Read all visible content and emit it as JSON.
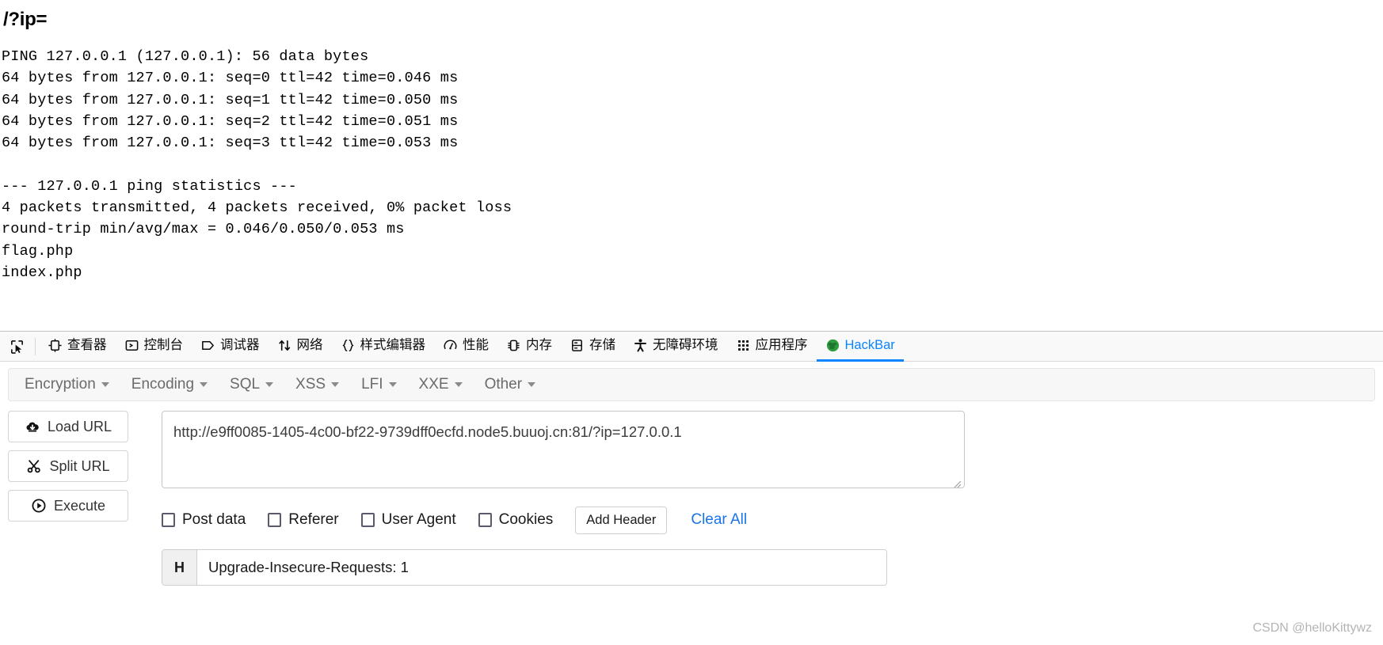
{
  "page": {
    "heading": "/?ip=",
    "ping_output": "PING 127.0.0.1 (127.0.0.1): 56 data bytes\n64 bytes from 127.0.0.1: seq=0 ttl=42 time=0.046 ms\n64 bytes from 127.0.0.1: seq=1 ttl=42 time=0.050 ms\n64 bytes from 127.0.0.1: seq=2 ttl=42 time=0.051 ms\n64 bytes from 127.0.0.1: seq=3 ttl=42 time=0.053 ms\n\n--- 127.0.0.1 ping statistics ---\n4 packets transmitted, 4 packets received, 0% packet loss\nround-trip min/avg/max = 0.046/0.050/0.053 ms\nflag.php\nindex.php"
  },
  "devtools": {
    "picker_icon": "element-picker-icon",
    "active_tab": "HackBar",
    "accent_color": "#0a84ff",
    "tabs": [
      {
        "label": "查看器",
        "icon": "inspector-icon"
      },
      {
        "label": "控制台",
        "icon": "console-icon"
      },
      {
        "label": "调试器",
        "icon": "debugger-icon"
      },
      {
        "label": "网络",
        "icon": "network-arrows-icon"
      },
      {
        "label": "样式编辑器",
        "icon": "style-editor-braces-icon"
      },
      {
        "label": "性能",
        "icon": "performance-gauge-icon"
      },
      {
        "label": "内存",
        "icon": "memory-chip-icon"
      },
      {
        "label": "存储",
        "icon": "storage-database-icon"
      },
      {
        "label": "无障碍环境",
        "icon": "accessibility-person-icon"
      },
      {
        "label": "应用程序",
        "icon": "application-grid-icon"
      },
      {
        "label": "HackBar",
        "icon": "hackbar-globe-icon"
      }
    ]
  },
  "hackbar": {
    "menus": [
      {
        "label": "Encryption"
      },
      {
        "label": "Encoding"
      },
      {
        "label": "SQL"
      },
      {
        "label": "XSS"
      },
      {
        "label": "LFI"
      },
      {
        "label": "XXE"
      },
      {
        "label": "Other"
      }
    ],
    "actions": [
      {
        "label": "Load URL",
        "icon": "cloud-download-icon"
      },
      {
        "label": "Split URL",
        "icon": "scissors-icon"
      },
      {
        "label": "Execute",
        "icon": "play-circle-icon"
      }
    ],
    "url": {
      "value": "http://e9ff0085-1405-4c00-bf22-9739dff0ecfd.node5.buuoj.cn:81/?ip=127.0.0.1",
      "placeholder": "Enter URL"
    },
    "checkboxes": [
      {
        "label": "Post data",
        "checked": false
      },
      {
        "label": "Referer",
        "checked": false
      },
      {
        "label": "User Agent",
        "checked": false
      },
      {
        "label": "Cookies",
        "checked": false
      }
    ],
    "add_header_label": "Add Header",
    "clear_all_label": "Clear All",
    "clear_all_color": "#1a73e8",
    "header_row": {
      "badge": "H",
      "value": "Upgrade-Insecure-Requests: 1",
      "placeholder": "Header: value"
    }
  },
  "watermark": "CSDN @helloKittywz"
}
